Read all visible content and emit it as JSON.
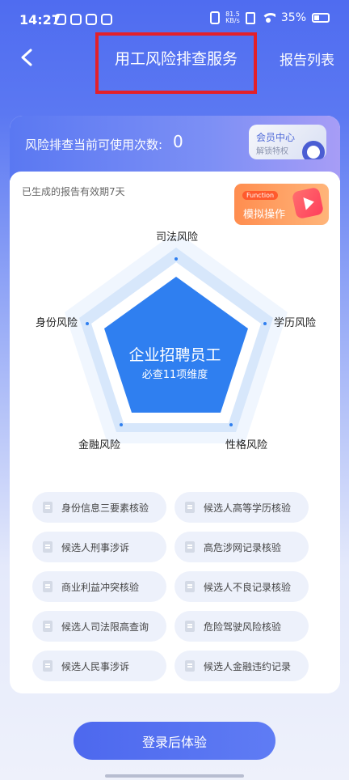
{
  "status_bar": {
    "time": "14:27",
    "net_speed_value": "81.5",
    "net_speed_unit": "KB/s",
    "battery": "35%"
  },
  "nav": {
    "title": "用工风险排查服务",
    "right_link": "报告列表"
  },
  "usage": {
    "label": "风险排查当前可使用次数:",
    "count": "0"
  },
  "member": {
    "title": "会员中心",
    "subtitle": "解锁特权"
  },
  "validity_note": "已生成的报告有效期7天",
  "simulate": {
    "tag": "Function",
    "label": "模拟操作"
  },
  "radar": {
    "axes": [
      "司法风险",
      "学历风险",
      "性格风险",
      "金融风险",
      "身份风险"
    ],
    "center_title": "企业招聘员工",
    "center_subtitle": "必查11项维度"
  },
  "checks": [
    "身份信息三要素核验",
    "候选人高等学历核验",
    "候选人刑事涉诉",
    "高危涉网记录核验",
    "商业利益冲突核验",
    "候选人不良记录核验",
    "候选人司法限高查询",
    "危险驾驶风险核验",
    "候选人民事涉诉",
    "候选人金融违约记录"
  ],
  "login_button": "登录后体验",
  "colors": {
    "accent": "#4f6cf0",
    "highlight_box": "#e3202a",
    "radar_fill": "#2f7ff0",
    "sim_button": "#ff8d4f"
  }
}
